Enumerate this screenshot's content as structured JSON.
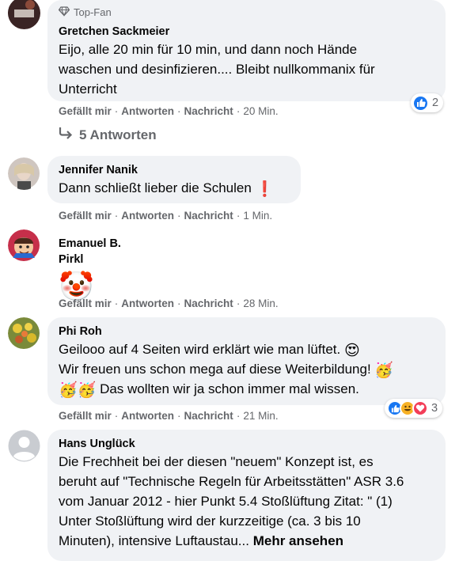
{
  "actions": {
    "like": "Gefällt mir",
    "reply": "Antworten",
    "message": "Nachricht",
    "separator": "·"
  },
  "comments": [
    {
      "badge": "Top-Fan",
      "author": "Gretchen Sackmeier",
      "lines": [
        "Eijo, alle 20 min für 10 min, und dann noch Hände",
        "waschen und desinfizieren.... Bleibt nullkommanix für",
        "Unterricht"
      ],
      "time": "20 Min.",
      "reaction_count": "2",
      "replies_label": "5 Antworten"
    },
    {
      "author": "Jennifer Nanik",
      "text": "Dann schließt lieber die Schulen",
      "emoji": "❗",
      "time": "1 Min."
    },
    {
      "author": "Emanuel B. Pirkl",
      "emoji": "🤡",
      "time": "28 Min."
    },
    {
      "author": "Phi Roh",
      "line1": "Geilooo auf 4 Seiten wird erklärt wie man lüftet.",
      "line1_emoji": "😍",
      "line2": "Wir freuen uns schon mega auf diese Weiterbildung!",
      "line2_emoji": "🥳",
      "line3_emoji": "🥳🥳",
      "line3": "Das wollten wir ja schon immer mal wissen.",
      "time": "21 Min.",
      "reaction_count": "3"
    },
    {
      "author": "Hans Unglück",
      "lines": [
        "Die Frechheit bei der diesen \"neuem\" Konzept ist, es",
        "beruht auf \"Technische Regeln für Arbeitsstätten\" ASR 3.6",
        "vom Januar 2012 - hier Punkt 5.4 Stoßlüftung Zitat: \" (1)",
        "Unter Stoßlüftung wird der kurzzeitige (ca. 3 bis 10"
      ],
      "last_line": "Minuten), intensive Luftaustau...",
      "see_more": "Mehr ansehen"
    }
  ],
  "colors": {
    "like_blue": "#1877f2",
    "love_red": "#f33e58",
    "haha_yellow": "#f7b125",
    "bubble_bg": "#f0f2f5",
    "muted": "#65676b"
  },
  "icons": [
    "top-fan-diamond-icon",
    "reply-arrow-icon",
    "like-icon",
    "haha-icon",
    "love-icon"
  ]
}
